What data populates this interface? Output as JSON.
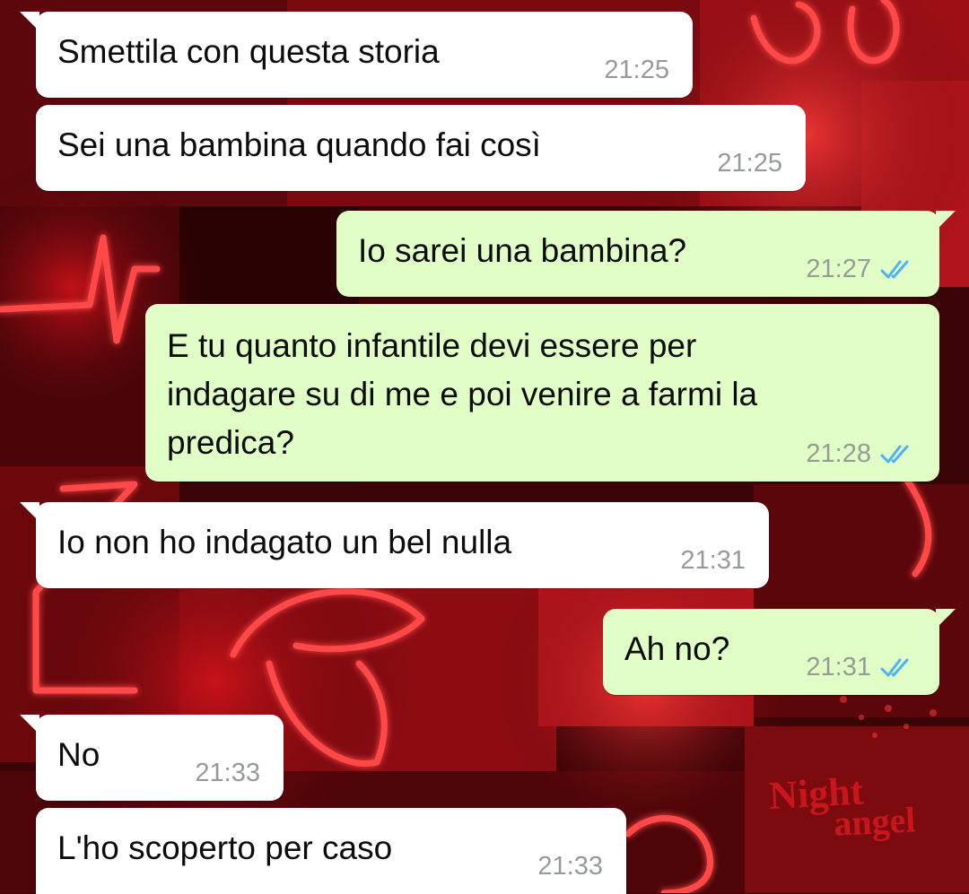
{
  "chat": {
    "messages": [
      {
        "direction": "incoming",
        "text": "Smettila con questa storia",
        "time": "21:25"
      },
      {
        "direction": "incoming",
        "text": "Sei una bambina quando fai così",
        "time": "21:25"
      },
      {
        "direction": "outgoing",
        "text": "Io sarei una bambina?",
        "time": "21:27",
        "status": "read"
      },
      {
        "direction": "outgoing",
        "text": "E tu quanto infantile devi essere per\nindagare su di me e poi venire a farmi la\npredica?",
        "time": "21:28",
        "status": "read"
      },
      {
        "direction": "incoming",
        "text": "Io non ho indagato un bel nulla",
        "time": "21:31"
      },
      {
        "direction": "outgoing",
        "text": "Ah no?",
        "time": "21:31",
        "status": "read"
      },
      {
        "direction": "incoming",
        "text": "No",
        "time": "21:33"
      },
      {
        "direction": "incoming",
        "text": "L'ho scoperto per caso",
        "time": "21:33"
      }
    ]
  },
  "wallpaper": {
    "neon_sign_a": "Night",
    "neon_sign_b": "angel"
  },
  "colors": {
    "incoming_bubble": "#ffffff",
    "outgoing_bubble": "#e1fec6",
    "timestamp": "#979b98",
    "read_ticks": "#4fb3f1",
    "wallpaper_base": "#3a0306",
    "neon_red": "#ff2a2a"
  },
  "icons": {
    "read_receipt": "double-check-icon"
  }
}
